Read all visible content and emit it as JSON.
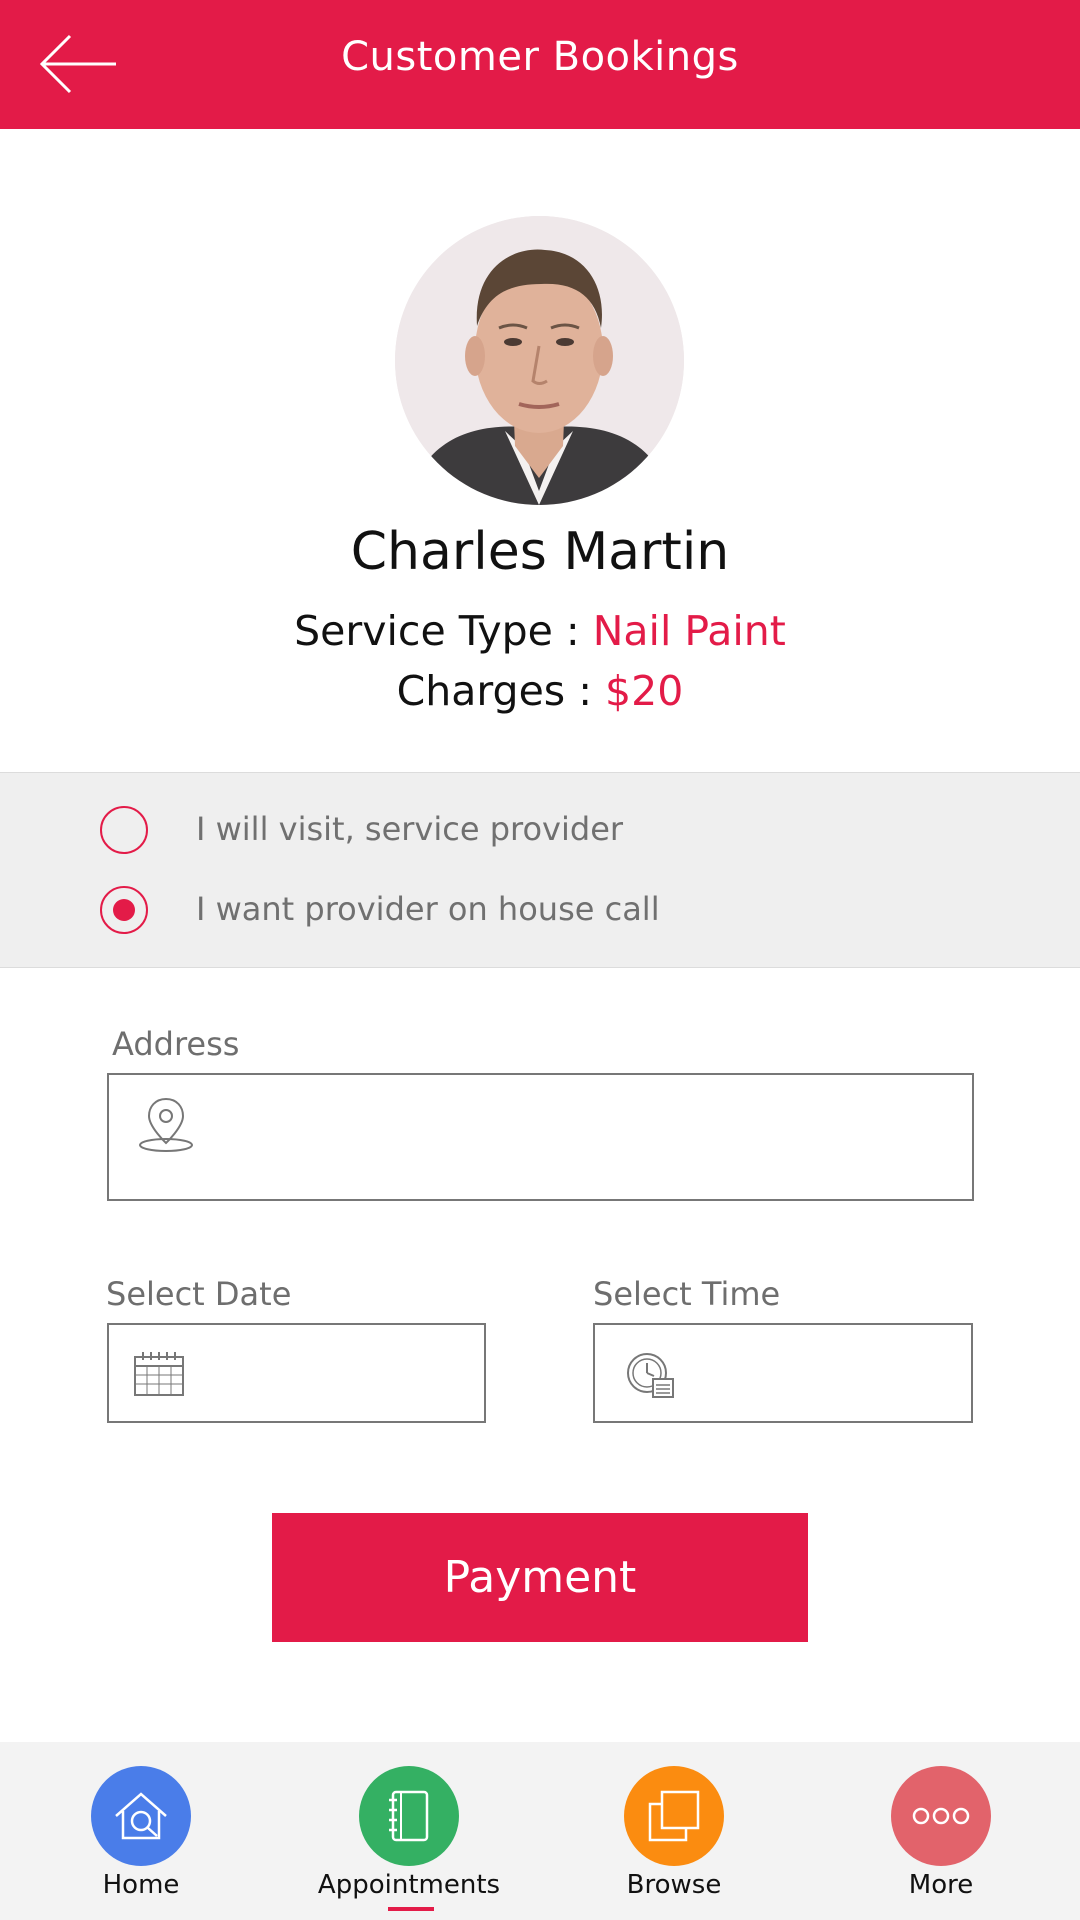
{
  "header": {
    "title": "Customer Bookings"
  },
  "profile": {
    "name": "Charles Martin",
    "service_type_label": "Service Type : ",
    "service_type_value": "Nail Paint",
    "charges_label": "Charges : ",
    "charges_value": "$20"
  },
  "visit_options": [
    {
      "label": "I will visit, service provider",
      "selected": false
    },
    {
      "label": "I want provider on house call",
      "selected": true
    }
  ],
  "form": {
    "address_label": "Address",
    "address_value": "",
    "date_label": "Select Date",
    "date_value": "",
    "time_label": "Select Time",
    "time_value": ""
  },
  "payment_button": "Payment",
  "bottom_nav": [
    {
      "label": "Home",
      "icon": "home-search-icon",
      "color": "#4a7de9"
    },
    {
      "label": "Appointments",
      "icon": "notebook-icon",
      "color": "#34b063",
      "active": true
    },
    {
      "label": "Browse",
      "icon": "layers-icon",
      "color": "#fb8c10"
    },
    {
      "label": "More",
      "icon": "more-dots-icon",
      "color": "#e2636b"
    }
  ],
  "colors": {
    "accent": "#e31b48",
    "option_band": "#efefef"
  }
}
